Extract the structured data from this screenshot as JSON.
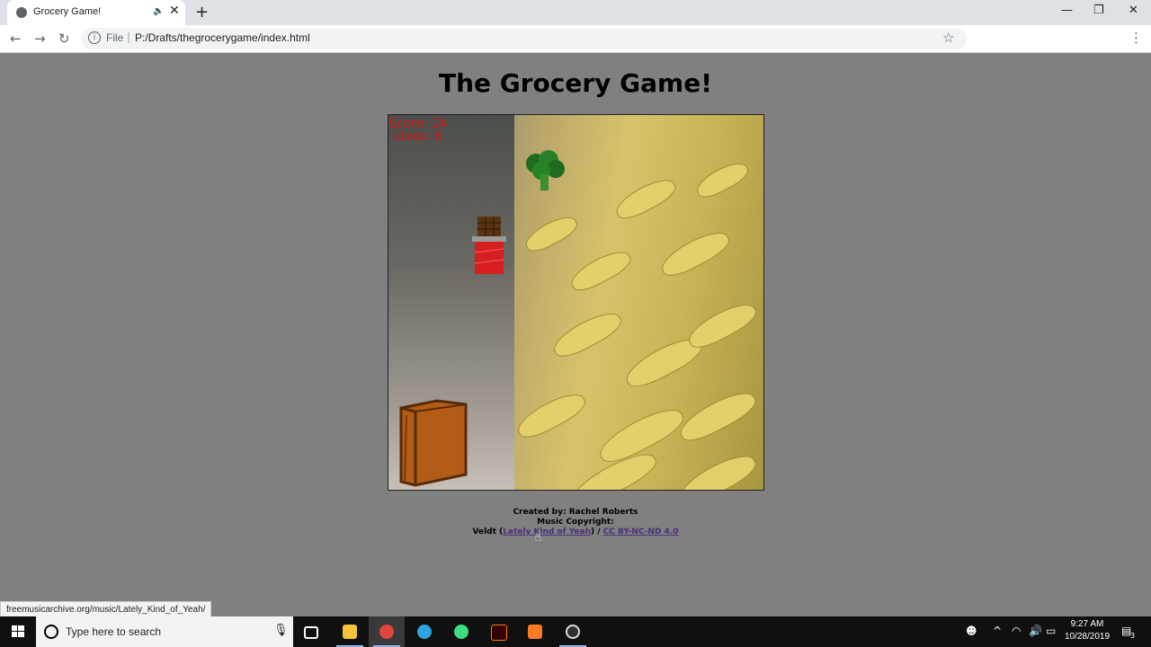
{
  "browser": {
    "tab_title": "Grocery Game!",
    "address_scheme": "File",
    "address_url": "P:/Drafts/thegrocerygame/index.html",
    "status_url": "freemusicarchive.org/music/Lately_Kind_of_Yeah/"
  },
  "page": {
    "title": "The Grocery Game!",
    "hud": {
      "score_label": "Score: 24",
      "lives_label": "Lives: 6"
    },
    "credits": {
      "created_by": "Created by: Rachel Roberts",
      "music_copyright": "Music Copyright:",
      "artist_prefix": "Veldt (",
      "song_link": "Lately Kind of Yeah",
      "separator": ") / ",
      "license_link": "CC BY-NC-ND 4.0"
    }
  },
  "taskbar": {
    "search_placeholder": "Type here to search",
    "time": "9:27 AM",
    "date": "10/28/2019",
    "notification_count": "3"
  },
  "colors": {
    "page_bg": "#808080",
    "hud_text": "#dd1111",
    "link": "#4b2f7a"
  }
}
